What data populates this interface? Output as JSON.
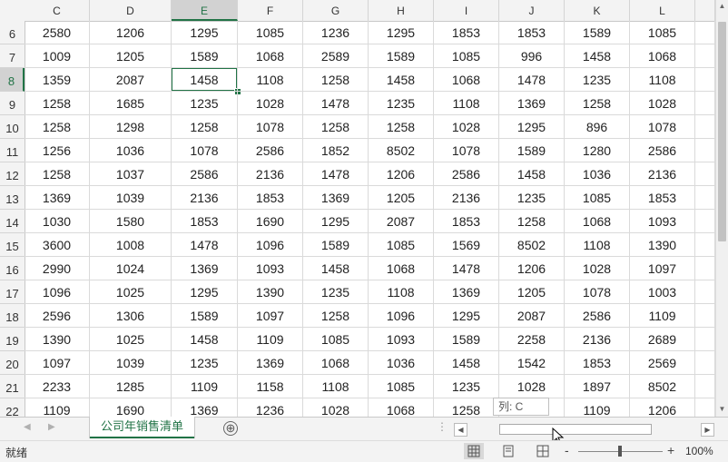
{
  "columns": [
    "C",
    "D",
    "E",
    "F",
    "G",
    "H",
    "I",
    "J",
    "K",
    "L"
  ],
  "active_column": "E",
  "rows": [
    {
      "num": "6",
      "cells": [
        "2580",
        "1206",
        "1295",
        "1085",
        "1236",
        "1295",
        "1853",
        "1853",
        "1589",
        "1085"
      ]
    },
    {
      "num": "7",
      "cells": [
        "1009",
        "1205",
        "1589",
        "1068",
        "2589",
        "1589",
        "1085",
        "996",
        "1458",
        "1068"
      ]
    },
    {
      "num": "8",
      "cells": [
        "1359",
        "2087",
        "1458",
        "1108",
        "1258",
        "1458",
        "1068",
        "1478",
        "1235",
        "1108"
      ]
    },
    {
      "num": "9",
      "cells": [
        "1258",
        "1685",
        "1235",
        "1028",
        "1478",
        "1235",
        "1108",
        "1369",
        "1258",
        "1028"
      ]
    },
    {
      "num": "10",
      "cells": [
        "1258",
        "1298",
        "1258",
        "1078",
        "1258",
        "1258",
        "1028",
        "1295",
        "896",
        "1078"
      ]
    },
    {
      "num": "11",
      "cells": [
        "1256",
        "1036",
        "1078",
        "2586",
        "1852",
        "8502",
        "1078",
        "1589",
        "1280",
        "2586"
      ]
    },
    {
      "num": "12",
      "cells": [
        "1258",
        "1037",
        "2586",
        "2136",
        "1478",
        "1206",
        "2586",
        "1458",
        "1036",
        "2136"
      ]
    },
    {
      "num": "13",
      "cells": [
        "1369",
        "1039",
        "2136",
        "1853",
        "1369",
        "1205",
        "2136",
        "1235",
        "1085",
        "1853"
      ]
    },
    {
      "num": "14",
      "cells": [
        "1030",
        "1580",
        "1853",
        "1690",
        "1295",
        "2087",
        "1853",
        "1258",
        "1068",
        "1093"
      ]
    },
    {
      "num": "15",
      "cells": [
        "3600",
        "1008",
        "1478",
        "1096",
        "1589",
        "1085",
        "1569",
        "8502",
        "1108",
        "1390"
      ]
    },
    {
      "num": "16",
      "cells": [
        "2990",
        "1024",
        "1369",
        "1093",
        "1458",
        "1068",
        "1478",
        "1206",
        "1028",
        "1097"
      ]
    },
    {
      "num": "17",
      "cells": [
        "1096",
        "1025",
        "1295",
        "1390",
        "1235",
        "1108",
        "1369",
        "1205",
        "1078",
        "1003"
      ]
    },
    {
      "num": "18",
      "cells": [
        "2596",
        "1306",
        "1589",
        "1097",
        "1258",
        "1096",
        "1295",
        "2087",
        "2586",
        "1109"
      ]
    },
    {
      "num": "19",
      "cells": [
        "1390",
        "1025",
        "1458",
        "1109",
        "1085",
        "1093",
        "1589",
        "2258",
        "2136",
        "2689"
      ]
    },
    {
      "num": "20",
      "cells": [
        "1097",
        "1039",
        "1235",
        "1369",
        "1068",
        "1036",
        "1458",
        "1542",
        "1853",
        "2569"
      ]
    },
    {
      "num": "21",
      "cells": [
        "2233",
        "1285",
        "1109",
        "1158",
        "1108",
        "1085",
        "1235",
        "1028",
        "1897",
        "8502"
      ]
    },
    {
      "num": "22",
      "cells": [
        "1109",
        "1690",
        "1369",
        "1236",
        "1028",
        "1068",
        "1258",
        "",
        "1109",
        "1206"
      ]
    }
  ],
  "active_row": "8",
  "sheet_tab": "公司年销售清单",
  "add_sheet_icon": "⊕",
  "tooltip": "列: C",
  "status": {
    "text": "就绪",
    "zoom_minus": "-",
    "zoom_plus": "+",
    "zoom_level": "100%"
  },
  "icons": {
    "tab_prev": "◀",
    "tab_next": "▶",
    "scroll_up": "▲",
    "scroll_down": "▼",
    "scroll_left": "◀",
    "scroll_right": "▶",
    "split": "⋮"
  },
  "colors": {
    "accent": "#217346",
    "header_bg": "#f3f3f3",
    "gridline": "#dadada"
  }
}
